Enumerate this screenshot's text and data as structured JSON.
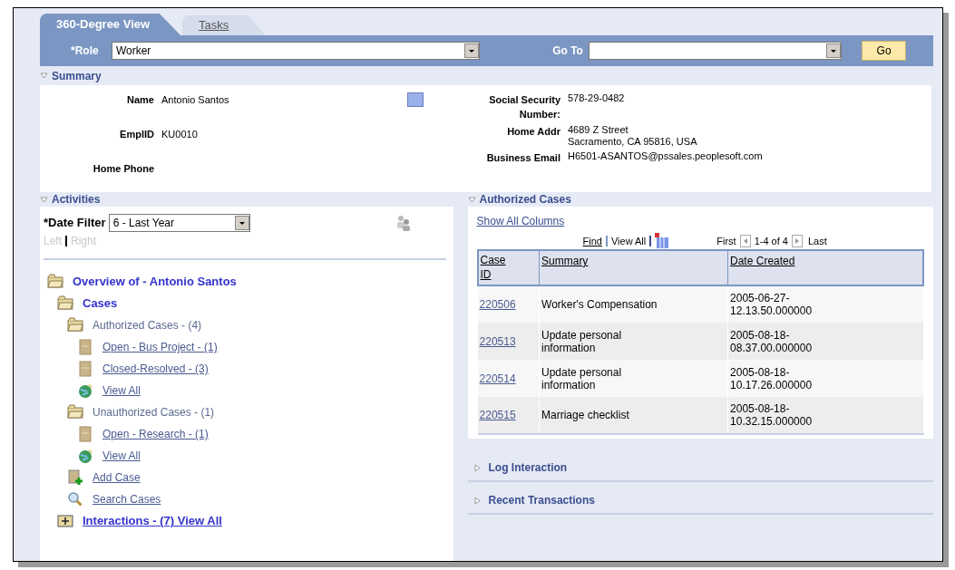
{
  "tabs": [
    {
      "label": "360-Degree View",
      "selected": true
    },
    {
      "label": "Tasks",
      "selected": false
    }
  ],
  "toolbar": {
    "role_label": "*Role",
    "role_value": "Worker",
    "goto_label": "Go To",
    "go_button": "Go"
  },
  "summary": {
    "title": "Summary",
    "expanded": true,
    "left_fields": [
      {
        "label": "Name",
        "value": "Antonio Santos"
      },
      {
        "label": "EmplID",
        "value": "KU0010"
      },
      {
        "label": "Home Phone"
      }
    ],
    "right_fields": [
      {
        "label": "Social Security Number:",
        "value": "578-29-0482"
      },
      {
        "label": "Home Addr",
        "value": "4689 Z Street\nSacramento, CA 95816, USA"
      },
      {
        "label": "Business Email",
        "value": "H6501-ASANTOS@pssales.peoplesoft.com"
      }
    ]
  },
  "activities": {
    "title": "Activities",
    "expanded": true,
    "date_filter_label": "*Date Filter",
    "date_filter_value": "6 - Last Year",
    "nav": [
      {
        "label": "Left",
        "disabled": true
      },
      {
        "label": "Right",
        "disabled": true
      }
    ],
    "tree": [
      {
        "label": "Overview of - Antonio Santos",
        "kind": "main-folder",
        "children": [
          {
            "label": "Cases",
            "kind": "main-folder",
            "children": [
              {
                "label": "Authorized Cases - (4)",
                "kind": "folder",
                "children": [
                  {
                    "label": "Open - Bus Project - (1)",
                    "kind": "doc"
                  },
                  {
                    "label": "Closed-Resolved - (3)",
                    "kind": "doc"
                  },
                  {
                    "label": "View All",
                    "kind": "globe"
                  }
                ]
              },
              {
                "label": "Unauthorized Cases - (1)",
                "kind": "folder",
                "children": [
                  {
                    "label": "Open - Research - (1)",
                    "kind": "doc"
                  },
                  {
                    "label": "View All",
                    "kind": "globe"
                  }
                ]
              },
              {
                "label": "Add Case",
                "kind": "add"
              },
              {
                "label": "Search Cases",
                "kind": "search"
              }
            ]
          },
          {
            "label": "Interactions - (7) View All",
            "kind": "closed-folder"
          }
        ]
      }
    ]
  },
  "cases": {
    "title": "Authorized Cases",
    "expanded": true,
    "show_all": "Show All Columns",
    "find": "Find",
    "view_all": "View All",
    "first": "First",
    "range": "1-4 of 4",
    "last": "Last",
    "columns": [
      "Case ID",
      "Summary",
      "Date Created"
    ],
    "rows": [
      [
        "220506",
        "Worker's Compensation",
        "2005-06-27-\n12.13.50.000000"
      ],
      [
        "220513",
        "Update personal\ninformation",
        "2005-08-18-\n08.37.00.000000"
      ],
      [
        "220514",
        "Update personal\ninformation",
        "2005-08-18-\n10.17.26.000000"
      ],
      [
        "220515",
        "Marriage checklist",
        "2005-08-18-\n10.32.15.000000"
      ]
    ]
  },
  "collapsed_sections": [
    {
      "title": "Log Interaction",
      "expanded": false
    },
    {
      "title": "Recent Transactions",
      "expanded": false
    }
  ]
}
